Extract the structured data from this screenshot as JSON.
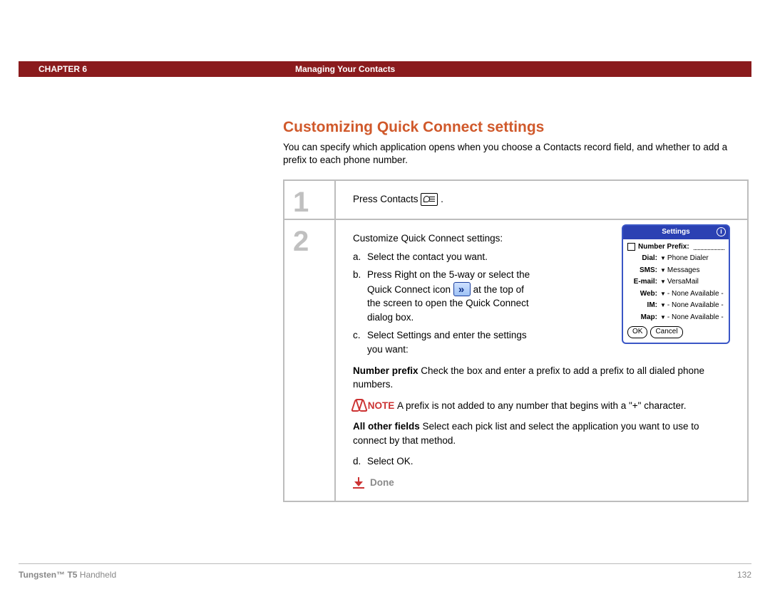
{
  "header": {
    "chapter": "CHAPTER 6",
    "title": "Managing Your Contacts"
  },
  "section": {
    "heading": "Customizing Quick Connect settings",
    "intro": "You can specify which application opens when you choose a Contacts record field, and whether to add a prefix to each phone number."
  },
  "steps": [
    {
      "num": "1",
      "lead": "Press Contacts ",
      "trail": "."
    },
    {
      "num": "2",
      "lead": "Customize Quick Connect settings:",
      "subs": {
        "a": {
          "letter": "a.",
          "text": "Select the contact you want."
        },
        "b": {
          "letter": "b.",
          "pre": "Press Right on the 5-way or select the Quick Connect icon ",
          "post": " at the top of the screen to open the Quick Connect dialog box."
        },
        "c": {
          "letter": "c.",
          "text": "Select Settings and enter the settings you want:"
        },
        "d": {
          "letter": "d.",
          "text": "Select OK."
        }
      },
      "blocks": {
        "numprefix_label": "Number prefix",
        "numprefix_text": "   Check the box and enter a prefix to add a prefix to all dialed phone numbers.",
        "note_label": " NOTE ",
        "note_text": "  A prefix is not added to any number that begins with a \"+\" character.",
        "other_label": "All other fields",
        "other_text": "   Select each pick list and select the application you want to use to connect by that method."
      },
      "done": "Done"
    }
  ],
  "palm": {
    "title": "Settings",
    "info": "i",
    "prefix_label": "Number Prefix:",
    "rows": [
      {
        "label": "Dial:",
        "value": "Phone Dialer"
      },
      {
        "label": "SMS:",
        "value": "Messages"
      },
      {
        "label": "E-mail:",
        "value": "VersaMail"
      },
      {
        "label": "Web:",
        "value": "- None Available -"
      },
      {
        "label": "IM:",
        "value": "- None Available -"
      },
      {
        "label": "Map:",
        "value": "- None Available -"
      }
    ],
    "ok": "OK",
    "cancel": "Cancel"
  },
  "footer": {
    "product_bold": "Tungsten™ T5",
    "product_rest": " Handheld",
    "page": "132"
  }
}
